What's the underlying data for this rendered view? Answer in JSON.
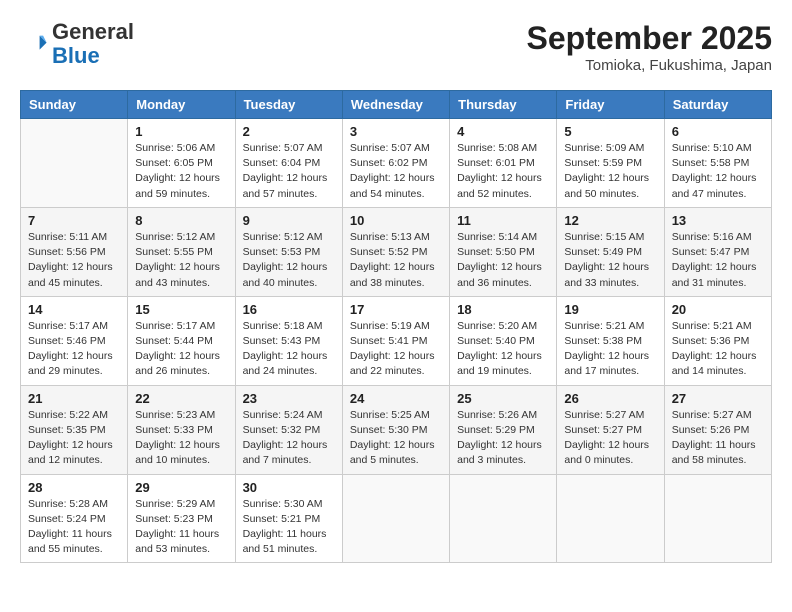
{
  "header": {
    "logo_general": "General",
    "logo_blue": "Blue",
    "month_title": "September 2025",
    "location": "Tomioka, Fukushima, Japan"
  },
  "columns": [
    "Sunday",
    "Monday",
    "Tuesday",
    "Wednesday",
    "Thursday",
    "Friday",
    "Saturday"
  ],
  "weeks": [
    [
      {
        "day": "",
        "info": ""
      },
      {
        "day": "1",
        "info": "Sunrise: 5:06 AM\nSunset: 6:05 PM\nDaylight: 12 hours\nand 59 minutes."
      },
      {
        "day": "2",
        "info": "Sunrise: 5:07 AM\nSunset: 6:04 PM\nDaylight: 12 hours\nand 57 minutes."
      },
      {
        "day": "3",
        "info": "Sunrise: 5:07 AM\nSunset: 6:02 PM\nDaylight: 12 hours\nand 54 minutes."
      },
      {
        "day": "4",
        "info": "Sunrise: 5:08 AM\nSunset: 6:01 PM\nDaylight: 12 hours\nand 52 minutes."
      },
      {
        "day": "5",
        "info": "Sunrise: 5:09 AM\nSunset: 5:59 PM\nDaylight: 12 hours\nand 50 minutes."
      },
      {
        "day": "6",
        "info": "Sunrise: 5:10 AM\nSunset: 5:58 PM\nDaylight: 12 hours\nand 47 minutes."
      }
    ],
    [
      {
        "day": "7",
        "info": "Sunrise: 5:11 AM\nSunset: 5:56 PM\nDaylight: 12 hours\nand 45 minutes."
      },
      {
        "day": "8",
        "info": "Sunrise: 5:12 AM\nSunset: 5:55 PM\nDaylight: 12 hours\nand 43 minutes."
      },
      {
        "day": "9",
        "info": "Sunrise: 5:12 AM\nSunset: 5:53 PM\nDaylight: 12 hours\nand 40 minutes."
      },
      {
        "day": "10",
        "info": "Sunrise: 5:13 AM\nSunset: 5:52 PM\nDaylight: 12 hours\nand 38 minutes."
      },
      {
        "day": "11",
        "info": "Sunrise: 5:14 AM\nSunset: 5:50 PM\nDaylight: 12 hours\nand 36 minutes."
      },
      {
        "day": "12",
        "info": "Sunrise: 5:15 AM\nSunset: 5:49 PM\nDaylight: 12 hours\nand 33 minutes."
      },
      {
        "day": "13",
        "info": "Sunrise: 5:16 AM\nSunset: 5:47 PM\nDaylight: 12 hours\nand 31 minutes."
      }
    ],
    [
      {
        "day": "14",
        "info": "Sunrise: 5:17 AM\nSunset: 5:46 PM\nDaylight: 12 hours\nand 29 minutes."
      },
      {
        "day": "15",
        "info": "Sunrise: 5:17 AM\nSunset: 5:44 PM\nDaylight: 12 hours\nand 26 minutes."
      },
      {
        "day": "16",
        "info": "Sunrise: 5:18 AM\nSunset: 5:43 PM\nDaylight: 12 hours\nand 24 minutes."
      },
      {
        "day": "17",
        "info": "Sunrise: 5:19 AM\nSunset: 5:41 PM\nDaylight: 12 hours\nand 22 minutes."
      },
      {
        "day": "18",
        "info": "Sunrise: 5:20 AM\nSunset: 5:40 PM\nDaylight: 12 hours\nand 19 minutes."
      },
      {
        "day": "19",
        "info": "Sunrise: 5:21 AM\nSunset: 5:38 PM\nDaylight: 12 hours\nand 17 minutes."
      },
      {
        "day": "20",
        "info": "Sunrise: 5:21 AM\nSunset: 5:36 PM\nDaylight: 12 hours\nand 14 minutes."
      }
    ],
    [
      {
        "day": "21",
        "info": "Sunrise: 5:22 AM\nSunset: 5:35 PM\nDaylight: 12 hours\nand 12 minutes."
      },
      {
        "day": "22",
        "info": "Sunrise: 5:23 AM\nSunset: 5:33 PM\nDaylight: 12 hours\nand 10 minutes."
      },
      {
        "day": "23",
        "info": "Sunrise: 5:24 AM\nSunset: 5:32 PM\nDaylight: 12 hours\nand 7 minutes."
      },
      {
        "day": "24",
        "info": "Sunrise: 5:25 AM\nSunset: 5:30 PM\nDaylight: 12 hours\nand 5 minutes."
      },
      {
        "day": "25",
        "info": "Sunrise: 5:26 AM\nSunset: 5:29 PM\nDaylight: 12 hours\nand 3 minutes."
      },
      {
        "day": "26",
        "info": "Sunrise: 5:27 AM\nSunset: 5:27 PM\nDaylight: 12 hours\nand 0 minutes."
      },
      {
        "day": "27",
        "info": "Sunrise: 5:27 AM\nSunset: 5:26 PM\nDaylight: 11 hours\nand 58 minutes."
      }
    ],
    [
      {
        "day": "28",
        "info": "Sunrise: 5:28 AM\nSunset: 5:24 PM\nDaylight: 11 hours\nand 55 minutes."
      },
      {
        "day": "29",
        "info": "Sunrise: 5:29 AM\nSunset: 5:23 PM\nDaylight: 11 hours\nand 53 minutes."
      },
      {
        "day": "30",
        "info": "Sunrise: 5:30 AM\nSunset: 5:21 PM\nDaylight: 11 hours\nand 51 minutes."
      },
      {
        "day": "",
        "info": ""
      },
      {
        "day": "",
        "info": ""
      },
      {
        "day": "",
        "info": ""
      },
      {
        "day": "",
        "info": ""
      }
    ]
  ]
}
